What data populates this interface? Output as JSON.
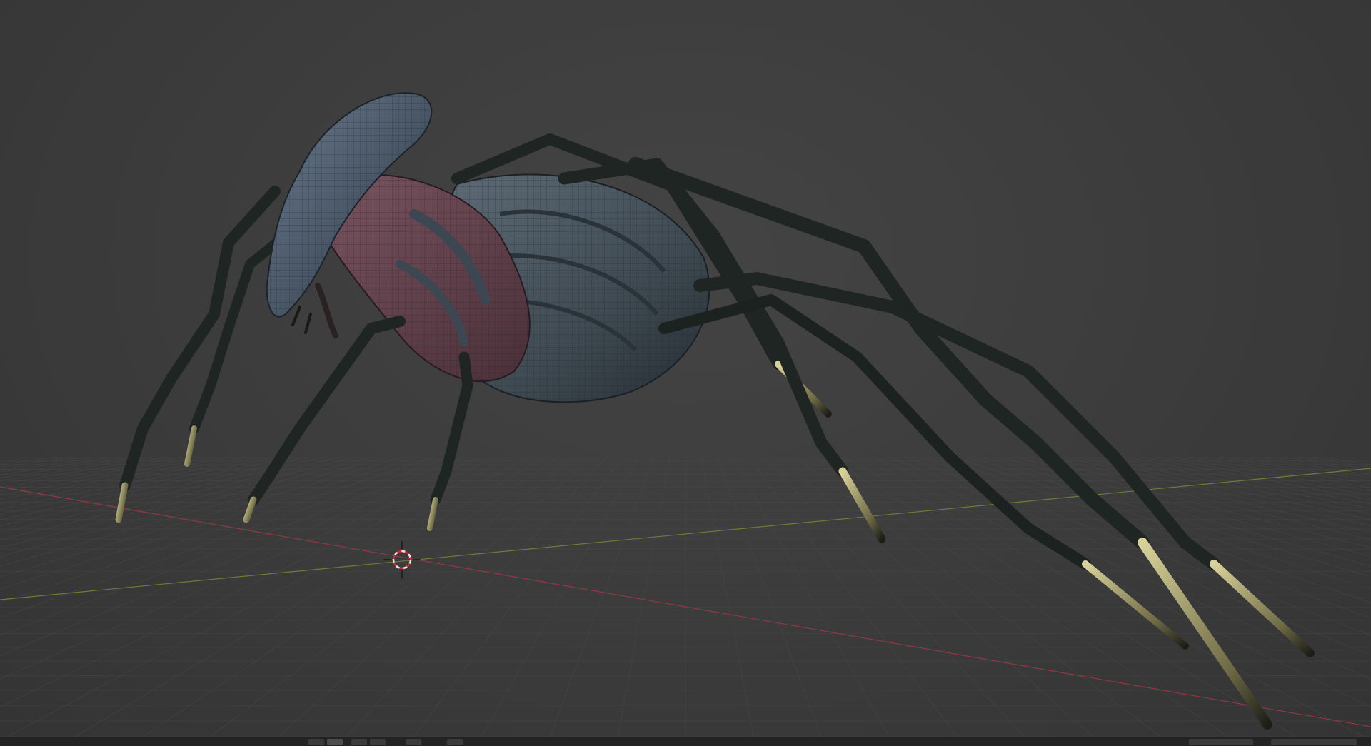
{
  "app": {
    "name": "3D viewport",
    "background_color": "#3d3d3d"
  },
  "viewport": {
    "grid_color": "#4a4a4a",
    "x_axis_color": "#8e3a45",
    "y_axis_color": "#6b7d3a",
    "cursor_icon": "3d-cursor-icon",
    "model_name": "",
    "model_colors": {
      "carapace": "#4c5a6a",
      "body_flesh": "#6e4650",
      "leg": "#1f2624",
      "claw": "#c9c28a"
    }
  },
  "bottom_bar": {
    "buttons": [
      {
        "icon": "select-icon",
        "active": false
      },
      {
        "icon": "box-select-icon",
        "active": true
      },
      {
        "icon": "mode-icon-1",
        "active": false
      },
      {
        "icon": "mode-icon-2",
        "active": false
      },
      {
        "icon": "mode-icon-3",
        "active": false
      },
      {
        "icon": "mode-icon-4",
        "active": false
      }
    ],
    "right_buttons": [
      {
        "icon": "status-icon-1"
      },
      {
        "icon": "status-icon-2"
      }
    ]
  }
}
